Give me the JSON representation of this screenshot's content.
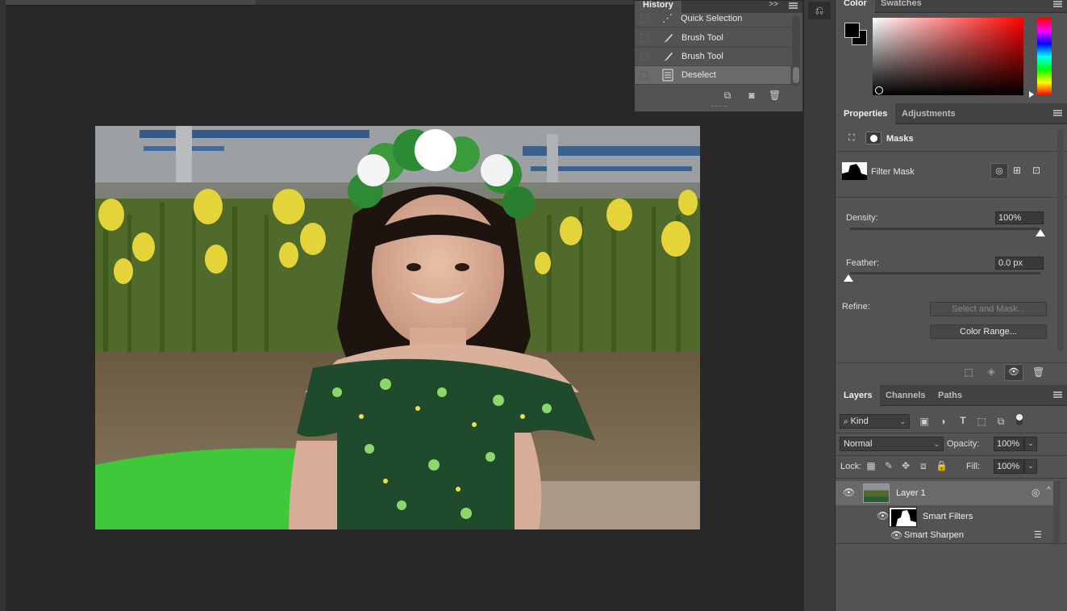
{
  "history": {
    "tab": "History",
    "items": [
      {
        "label": "Quick Selection",
        "icon": "quick-selection-icon"
      },
      {
        "label": "Brush Tool",
        "icon": "brush-icon"
      },
      {
        "label": "Brush Tool",
        "icon": "brush-icon"
      },
      {
        "label": "Deselect",
        "icon": "document-icon",
        "selected": true
      }
    ],
    "expand": ">>"
  },
  "color_panel": {
    "tabs": [
      "Color",
      "Swatches"
    ],
    "foreground": "#000000",
    "background": "#000000",
    "hue_color": "#ff0000"
  },
  "properties": {
    "tabs": [
      "Properties",
      "Adjustments"
    ],
    "section": "Masks",
    "mask_name": "Filter Mask",
    "density_label": "Density:",
    "density_value": "100%",
    "density_level": 1.0,
    "feather_label": "Feather:",
    "feather_value": "0.0 px",
    "feather_level": 0.0,
    "refine_label": "Refine:",
    "select_and_mask": "Select and Mask...",
    "color_range": "Color Range..."
  },
  "layers": {
    "tabs": [
      "Layers",
      "Channels",
      "Paths"
    ],
    "filter_kind": "Kind",
    "blend_mode": "Normal",
    "opacity_label": "Opacity:",
    "opacity_value": "100%",
    "lock_label": "Lock:",
    "fill_label": "Fill:",
    "fill_value": "100%",
    "items": {
      "layer1": "Layer 1",
      "smart_filters": "Smart Filters",
      "smart_sharpen": "Smart Sharpen"
    }
  }
}
